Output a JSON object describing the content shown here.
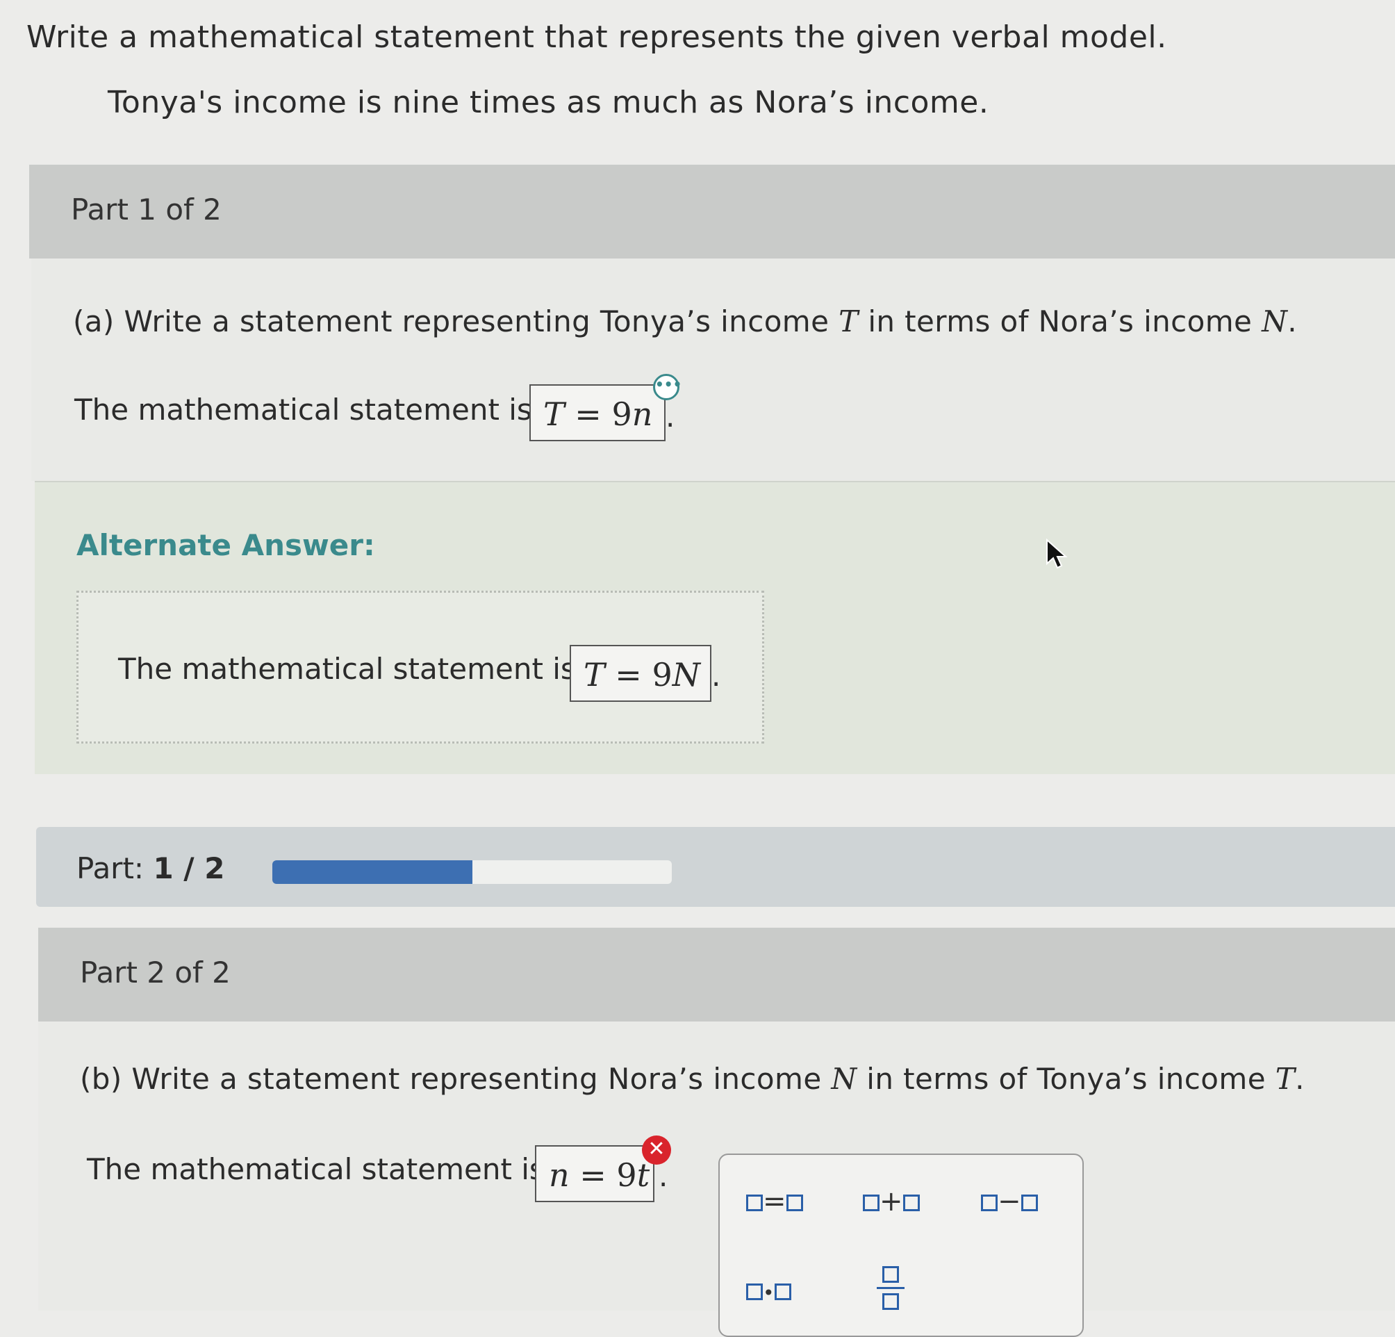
{
  "problem": {
    "instruction": "Write a mathematical statement that represents the given verbal model.",
    "verbal_model": "Tonya's income is nine times as much as Nora’s income."
  },
  "part1": {
    "header": "Part 1 of 2",
    "question_prefix": "(a) Write a statement representing Tonya’s income",
    "question_var1": "T",
    "question_mid": "in terms of Nora’s income",
    "question_var2": "N",
    "question_end": ".",
    "statement_label": "The mathematical statement is",
    "answer_lhs": "T",
    "answer_eq": " = 9",
    "answer_var": "n",
    "answer_end": ".",
    "more_icon": "ellipsis-icon"
  },
  "alternate": {
    "title": "Alternate Answer:",
    "statement_label": "The mathematical statement is",
    "answer_lhs": "T",
    "answer_eq": " = 9",
    "answer_var": "N",
    "answer_end": "."
  },
  "progress": {
    "label": "Part:",
    "value": "1 / 2",
    "fraction": 0.5,
    "fill_color": "#3d6fb2"
  },
  "part2": {
    "header": "Part 2 of 2",
    "question_prefix": "(b) Write a statement representing Nora’s income",
    "question_var1": "N",
    "question_mid": "in terms of Tonya’s income",
    "question_var2": "T",
    "question_end": ".",
    "statement_label": "The mathematical statement is",
    "answer_lhs": "n",
    "answer_eq": " = 9",
    "answer_var": "t",
    "answer_end": ".",
    "status_icon": "incorrect-x-icon"
  },
  "palette": {
    "equals": "=",
    "plus": "+",
    "minus": "−",
    "dot": "•"
  },
  "colors": {
    "accent_teal": "#3a8a8c",
    "error_red": "#d9242c",
    "palette_blue": "#2a5fa8"
  }
}
